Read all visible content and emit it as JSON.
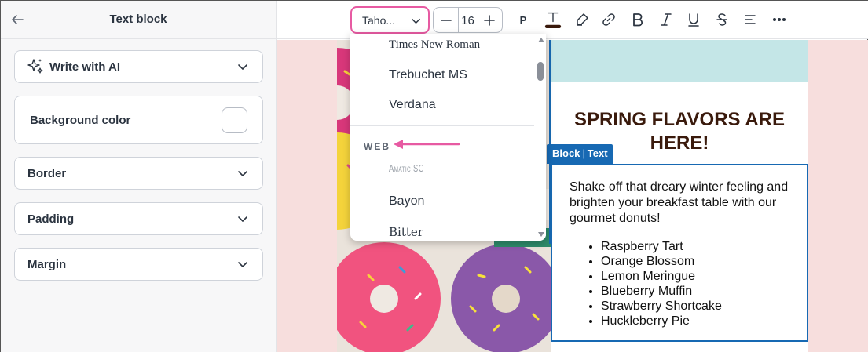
{
  "sidebar": {
    "title": "Text block",
    "back_icon": "arrow-left-icon",
    "sections": [
      {
        "label": "Write with AI",
        "icon": "sparkle-icon"
      },
      {
        "label": "Background color"
      },
      {
        "label": "Border"
      },
      {
        "label": "Padding"
      },
      {
        "label": "Margin"
      }
    ]
  },
  "toolbar": {
    "font_family": "Taho...",
    "font_size": "16",
    "paragraph_label": "P",
    "icons": [
      "text-color-icon",
      "highlighter-icon",
      "link-icon",
      "bold-icon",
      "italic-icon",
      "underline-icon",
      "strikethrough-icon",
      "align-left-icon",
      "more-icon"
    ],
    "text_color": "#3a1a0c",
    "highlight_border": "#e75aa2"
  },
  "font_dropdown": {
    "system_fonts": [
      "Times New Roman",
      "Trebuchet MS",
      "Verdana"
    ],
    "section_label": "WEB",
    "web_fonts": [
      "Amatic SC",
      "Bayon",
      "Bitter"
    ],
    "arrow_color": "#e75aa2"
  },
  "email": {
    "headline": "SPRING FLAVORS ARE HERE!",
    "block_tag": {
      "block": "Block",
      "separator": "|",
      "type": "Text"
    },
    "paragraph": "Shake off that dreary winter feeling and brighten your breakfast table with our gourmet donuts!",
    "flavors": [
      "Raspberry Tart",
      "Orange Blossom",
      "Lemon Meringue",
      "Blueberry Muffin",
      "Strawberry Shortcake",
      "Huckleberry Pie"
    ],
    "colors": {
      "teal_band": "#c4e6e7",
      "selection": "#1769b3",
      "canvas_bg": "#f7dedd"
    }
  }
}
